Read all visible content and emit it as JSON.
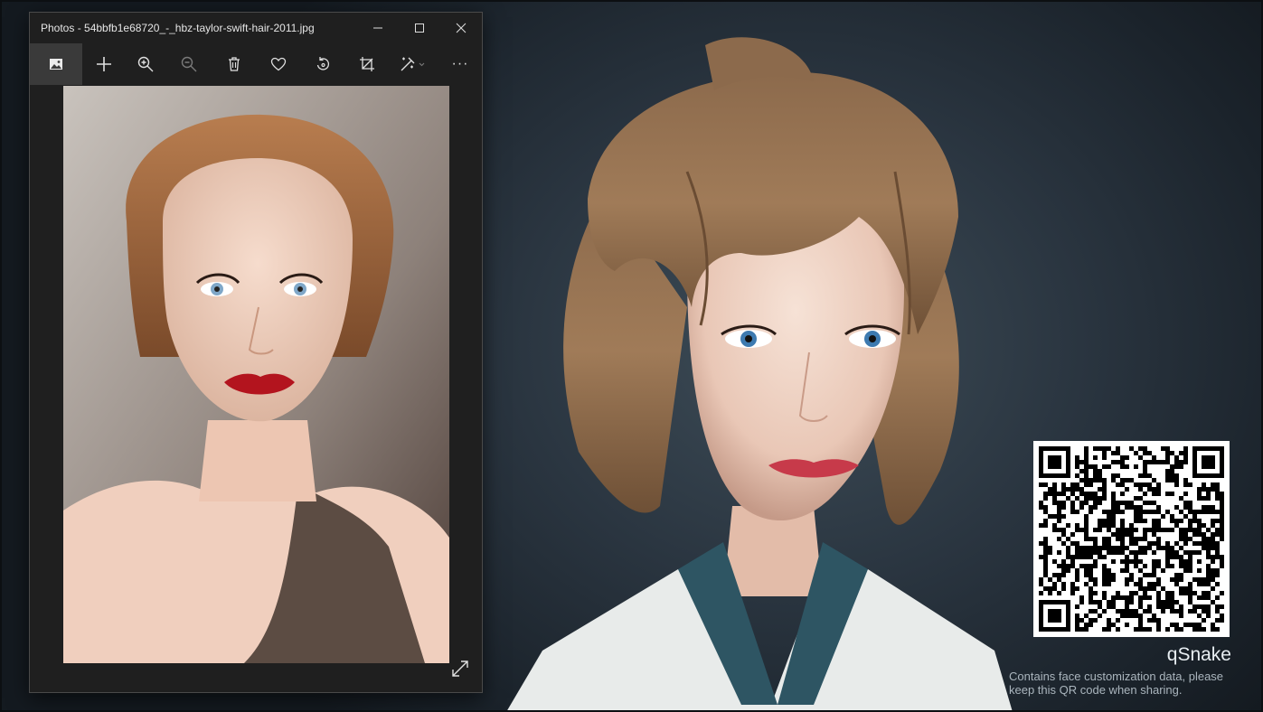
{
  "photos_window": {
    "title": "Photos - 54bbfb1e68720_-_hbz-taylor-swift-hair-2011.jpg",
    "controls": {
      "minimize": "minimize-icon",
      "maximize": "maximize-icon",
      "close": "close-icon"
    },
    "toolbar": [
      {
        "name": "photo-icon",
        "active": true
      },
      {
        "name": "add-icon"
      },
      {
        "name": "zoom-in-icon"
      },
      {
        "name": "zoom-out-icon"
      },
      {
        "name": "delete-icon"
      },
      {
        "name": "favorite-icon"
      },
      {
        "name": "rotate-icon"
      },
      {
        "name": "crop-icon"
      },
      {
        "name": "edit-icon"
      },
      {
        "name": "more-icon",
        "label": "···"
      }
    ],
    "expand_icon": "expand-icon"
  },
  "qr": {
    "title": "qSnake",
    "note": "Contains face customization data, please keep this QR code when sharing."
  },
  "colors": {
    "window_bg": "#1f1f1f",
    "active_tool": "#3a3a3a",
    "scene_bg": "#2a3540"
  }
}
